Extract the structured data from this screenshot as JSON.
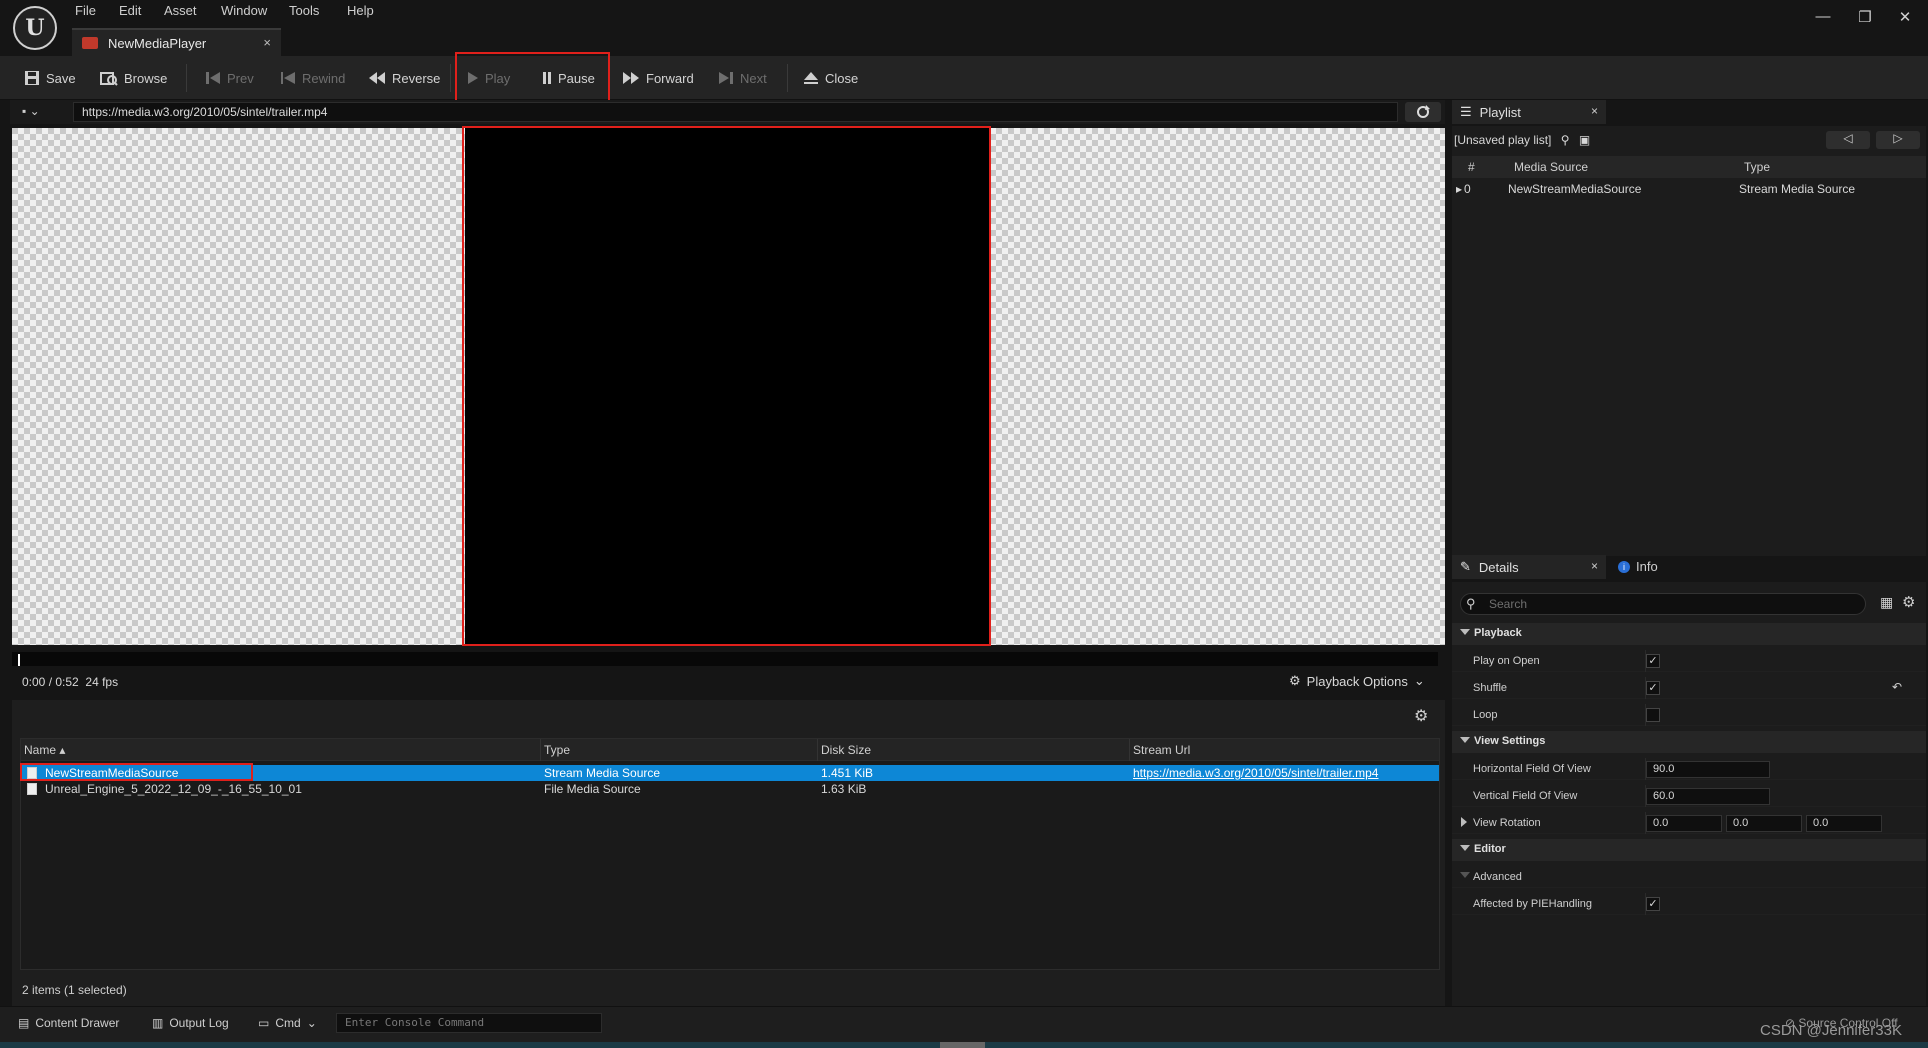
{
  "menu": [
    "File",
    "Edit",
    "Asset",
    "Window",
    "Tools",
    "Help"
  ],
  "document_tab": {
    "label": "NewMediaPlayer",
    "close": "×"
  },
  "window_controls": {
    "minimize": "—",
    "restore": "❐",
    "close": "✕"
  },
  "toolbar": {
    "save": "Save",
    "browse": "Browse",
    "prev": "Prev",
    "rewind": "Rewind",
    "reverse": "Reverse",
    "play": "Play",
    "pause": "Pause",
    "forward": "Forward",
    "next": "Next",
    "close": "Close"
  },
  "url_bar": {
    "url": "https://media.w3.org/2010/05/sintel/trailer.mp4"
  },
  "playback": {
    "time": "0:00 / 0:52",
    "fps": "24 fps",
    "options_label": "Playback Options"
  },
  "media_list": {
    "columns": [
      "Name",
      "Type",
      "Disk Size",
      "Stream Url"
    ],
    "rows": [
      {
        "name": "NewStreamMediaSource",
        "type": "Stream Media Source",
        "size": "1.451 KiB",
        "url": "https://media.w3.org/2010/05/sintel/trailer.mp4",
        "selected": true
      },
      {
        "name": "Unreal_Engine_5_2022_12_09_-_16_55_10_01",
        "type": "File Media Source",
        "size": "1.63 KiB",
        "url": "",
        "selected": false
      }
    ],
    "count": "2 items (1 selected)"
  },
  "playlist": {
    "tab": "Playlist",
    "name": "[Unsaved play list]",
    "columns": [
      "#",
      "Media Source",
      "Type"
    ],
    "rows": [
      {
        "index": "0",
        "source": "NewStreamMediaSource",
        "type": "Stream Media Source"
      }
    ]
  },
  "details": {
    "tab": "Details",
    "info_tab": "Info",
    "search_placeholder": "Search",
    "categories": {
      "playback": "Playback",
      "view_settings": "View Settings",
      "editor": "Editor",
      "advanced": "Advanced"
    },
    "props": {
      "play_on_open": {
        "label": "Play on Open",
        "checked": true
      },
      "shuffle": {
        "label": "Shuffle",
        "checked": true
      },
      "loop": {
        "label": "Loop",
        "checked": false
      },
      "hfov": {
        "label": "Horizontal Field Of View",
        "value": "90.0"
      },
      "vfov": {
        "label": "Vertical Field Of View",
        "value": "60.0"
      },
      "view_rotation": {
        "label": "View Rotation",
        "x": "0.0",
        "y": "0.0",
        "z": "0.0"
      },
      "affected_pie": {
        "label": "Affected by PIEHandling",
        "checked": true
      }
    }
  },
  "status_bar": {
    "content_drawer": "Content Drawer",
    "output_log": "Output Log",
    "cmd": "Cmd",
    "console_placeholder": "Enter Console Command",
    "source_control": "Source Control Off"
  },
  "watermark": "CSDN @Jennifer33K",
  "colors": {
    "highlight": "#e0201b",
    "selection": "#0d87d6",
    "accent_brand": "#c0392b"
  }
}
